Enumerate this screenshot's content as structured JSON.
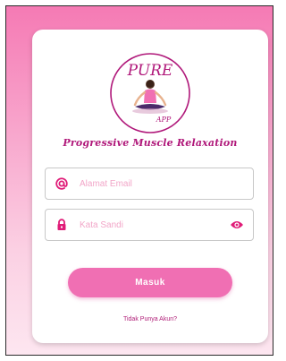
{
  "logo": {
    "brand_text": "PURE",
    "sub_text": "APP"
  },
  "tagline": "Progressive Muscle Relaxation",
  "email_field": {
    "placeholder": "Alamat Email",
    "value": "",
    "icon": "at-icon"
  },
  "password_field": {
    "placeholder": "Kata Sandi",
    "value": "",
    "icon": "lock-icon",
    "toggle_icon": "eye-icon"
  },
  "login_button": {
    "label": "Masuk"
  },
  "register_link": {
    "label": "Tidak Punya Akun?"
  },
  "colors": {
    "accent": "#f06fb3",
    "brand": "#b0187a",
    "icon": "#e01c78"
  }
}
